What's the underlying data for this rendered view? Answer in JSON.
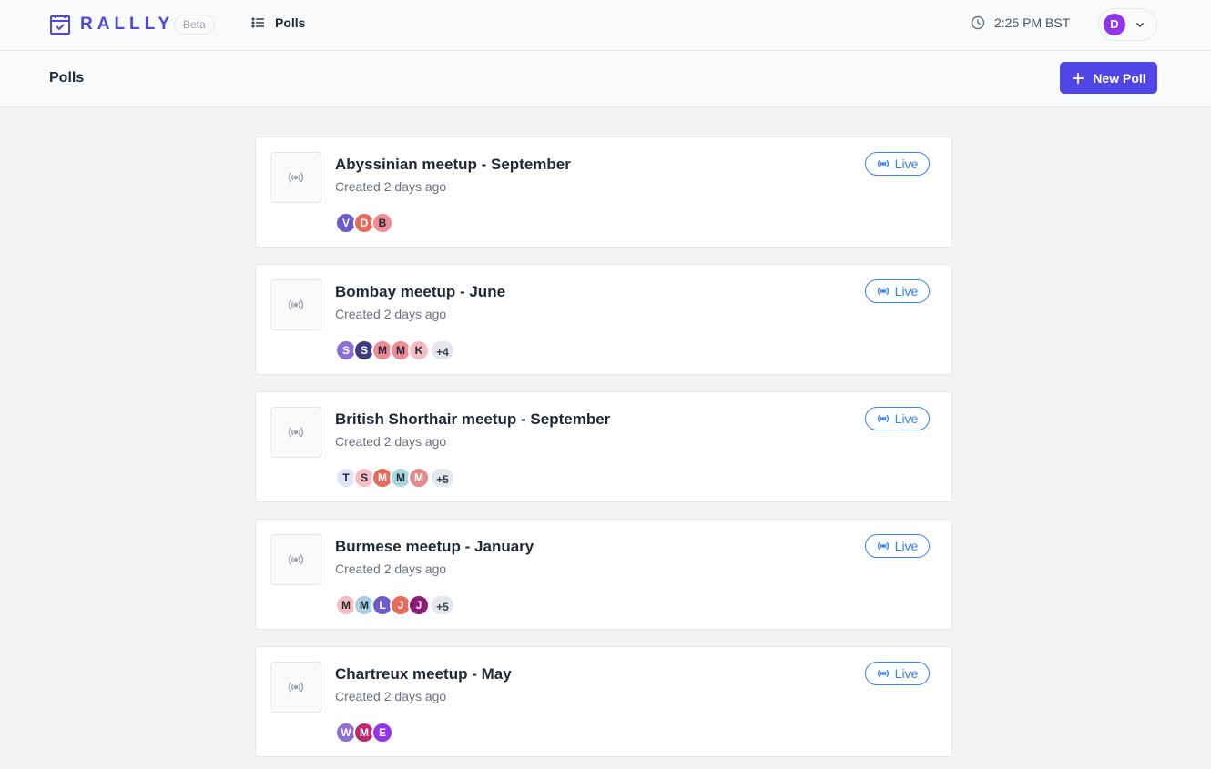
{
  "app": {
    "name": "RALLLY",
    "badge": "Beta"
  },
  "nav": {
    "polls_label": "Polls"
  },
  "header": {
    "time": "2:25 PM BST",
    "user_initial": "D",
    "user_color": "#9333ea"
  },
  "subheader": {
    "title": "Polls",
    "new_poll_label": "New Poll"
  },
  "status_color": "#3b82f6",
  "polls": [
    {
      "title": "Abyssinian meetup - September",
      "created": "Created 2 days ago",
      "status": "Live",
      "participants": [
        {
          "initial": "V",
          "color": "#6d5bd0",
          "text": "light"
        },
        {
          "initial": "D",
          "color": "#ea6a5a",
          "text": "light"
        },
        {
          "initial": "B",
          "color": "#f08a94",
          "text": "dark"
        }
      ],
      "more": ""
    },
    {
      "title": "Bombay meetup - June",
      "created": "Created 2 days ago",
      "status": "Live",
      "participants": [
        {
          "initial": "S",
          "color": "#8b6fd6",
          "text": "light"
        },
        {
          "initial": "S",
          "color": "#3f3c7e",
          "text": "light"
        },
        {
          "initial": "M",
          "color": "#f08a94",
          "text": "dark"
        },
        {
          "initial": "M",
          "color": "#f08a94",
          "text": "dark"
        },
        {
          "initial": "K",
          "color": "#f6bcc4",
          "text": "dark"
        }
      ],
      "more": "+4"
    },
    {
      "title": "British Shorthair meetup - September",
      "created": "Created 2 days ago",
      "status": "Live",
      "participants": [
        {
          "initial": "T",
          "color": "#e0e2f5",
          "text": "dark"
        },
        {
          "initial": "S",
          "color": "#f6bcc4",
          "text": "dark"
        },
        {
          "initial": "M",
          "color": "#ea6a5a",
          "text": "light"
        },
        {
          "initial": "M",
          "color": "#a9d8e0",
          "text": "dark"
        },
        {
          "initial": "M",
          "color": "#e58a8a",
          "text": "light"
        }
      ],
      "more": "+5"
    },
    {
      "title": "Burmese meetup - January",
      "created": "Created 2 days ago",
      "status": "Live",
      "participants": [
        {
          "initial": "M",
          "color": "#f6bcc4",
          "text": "dark"
        },
        {
          "initial": "M",
          "color": "#a9d0e6",
          "text": "dark"
        },
        {
          "initial": "L",
          "color": "#6d5bd0",
          "text": "light"
        },
        {
          "initial": "J",
          "color": "#ea6a5a",
          "text": "light"
        },
        {
          "initial": "J",
          "color": "#8b1d74",
          "text": "light"
        }
      ],
      "more": "+5"
    },
    {
      "title": "Chartreux meetup - May",
      "created": "Created 2 days ago",
      "status": "Live",
      "participants": [
        {
          "initial": "W",
          "color": "#8b6fd6",
          "text": "light"
        },
        {
          "initial": "M",
          "color": "#c02a6f",
          "text": "light"
        },
        {
          "initial": "E",
          "color": "#9333ea",
          "text": "light"
        }
      ],
      "more": ""
    }
  ]
}
